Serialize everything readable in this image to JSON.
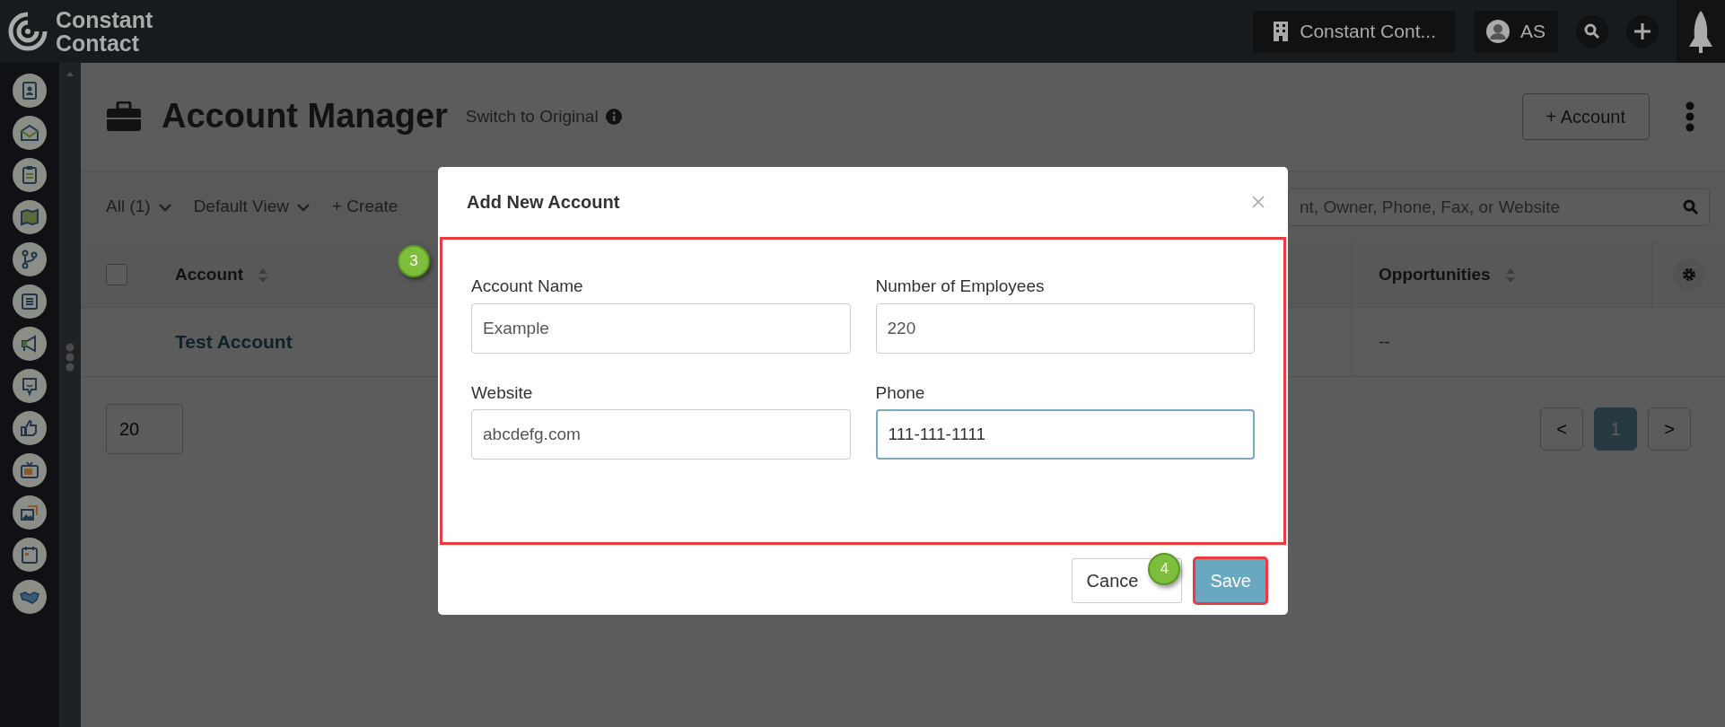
{
  "topbar": {
    "logo_lines": [
      "Constant",
      "Contact"
    ],
    "account_switch": "Constant Cont...",
    "user_initials": "AS"
  },
  "page": {
    "title": "Account Manager",
    "switch_link": "Switch to Original",
    "add_button": "+ Account"
  },
  "toolbar": {
    "filters": [
      {
        "label": "All (1)",
        "dropdown": true
      },
      {
        "label": "Default View",
        "dropdown": true
      },
      {
        "label": "+ Create",
        "dropdown": false
      }
    ],
    "search": {
      "placeholder": "nt, Owner, Phone, Fax, or Website"
    }
  },
  "table": {
    "select_all_checked": false,
    "columns": [
      {
        "label": "Account",
        "sortable": true
      },
      {
        "label": "Opportunities",
        "sortable": true
      }
    ],
    "rows": [
      {
        "cells": [
          "Test Account",
          "--"
        ]
      }
    ]
  },
  "pagination": {
    "page_size": "20",
    "prev": "<",
    "next": ">",
    "pages": [
      {
        "label": "1",
        "selected": true
      }
    ]
  },
  "dialog": {
    "title": "Add New Account",
    "highlighted": true,
    "fields": [
      {
        "label": "Account Name",
        "value": "Example",
        "focused": false
      },
      {
        "label": "Number of Employees",
        "value": "220",
        "focused": false
      },
      {
        "label": "Website",
        "value": "abcdefg.com",
        "focused": false
      },
      {
        "label": "Phone",
        "value": "111-111-1111",
        "focused": true
      }
    ],
    "buttons": [
      {
        "label": "Cance",
        "kind": "secondary",
        "highlighted": false
      },
      {
        "label": "Save",
        "kind": "primary",
        "highlighted": true
      }
    ]
  },
  "annotations": [
    {
      "label": "3"
    },
    {
      "label": "4"
    }
  ]
}
